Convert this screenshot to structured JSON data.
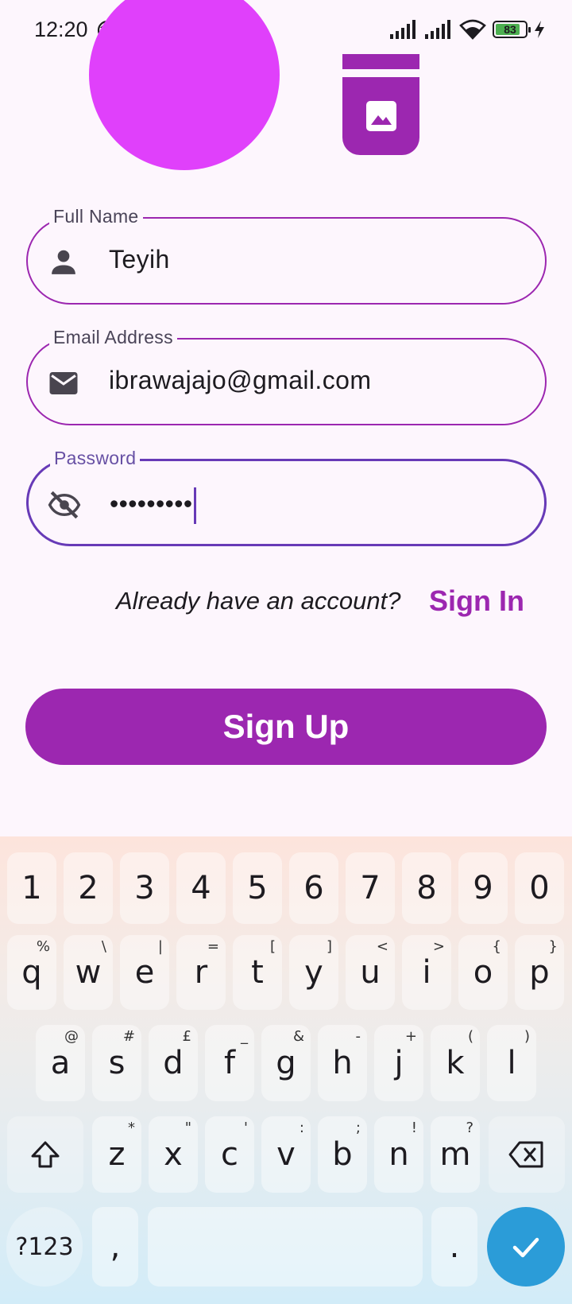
{
  "status_bar": {
    "time": "12:20",
    "battery": "83",
    "battery_level": 0.83
  },
  "form": {
    "full_name": {
      "label": "Full Name",
      "value": "Teyih",
      "icon": "person-icon"
    },
    "email": {
      "label": "Email Address",
      "value": "ibrawajajo@gmail.com",
      "icon": "mail-icon"
    },
    "password": {
      "label": "Password",
      "value": "•••••••••",
      "icon": "visibility-off-icon"
    }
  },
  "already_text": "Already have an account?",
  "signin_label": "Sign In",
  "signup_label": "Sign Up",
  "colors": {
    "primary": "#9c27b0",
    "avatar": "#e040fb",
    "focus": "#673ab7",
    "background": "#fdf6fd",
    "enter_key": "#2b9cd8"
  },
  "keyboard": {
    "numbers": [
      "1",
      "2",
      "3",
      "4",
      "5",
      "6",
      "7",
      "8",
      "9",
      "0"
    ],
    "row1": [
      {
        "key": "q",
        "sub": "%"
      },
      {
        "key": "w",
        "sub": "\\"
      },
      {
        "key": "e",
        "sub": "|"
      },
      {
        "key": "r",
        "sub": "="
      },
      {
        "key": "t",
        "sub": "["
      },
      {
        "key": "y",
        "sub": "]"
      },
      {
        "key": "u",
        "sub": "<"
      },
      {
        "key": "i",
        "sub": ">"
      },
      {
        "key": "o",
        "sub": "{"
      },
      {
        "key": "p",
        "sub": "}"
      }
    ],
    "row2": [
      {
        "key": "a",
        "sub": "@"
      },
      {
        "key": "s",
        "sub": "#"
      },
      {
        "key": "d",
        "sub": "£"
      },
      {
        "key": "f",
        "sub": "_"
      },
      {
        "key": "g",
        "sub": "&"
      },
      {
        "key": "h",
        "sub": "-"
      },
      {
        "key": "j",
        "sub": "+"
      },
      {
        "key": "k",
        "sub": "("
      },
      {
        "key": "l",
        "sub": ")"
      }
    ],
    "row3": [
      {
        "key": "z",
        "sub": "*"
      },
      {
        "key": "x",
        "sub": "\""
      },
      {
        "key": "c",
        "sub": "'"
      },
      {
        "key": "v",
        "sub": ":"
      },
      {
        "key": "b",
        "sub": ";"
      },
      {
        "key": "n",
        "sub": "!"
      },
      {
        "key": "m",
        "sub": "?"
      }
    ],
    "symbols_label": "?123",
    "comma": ",",
    "period": "."
  }
}
